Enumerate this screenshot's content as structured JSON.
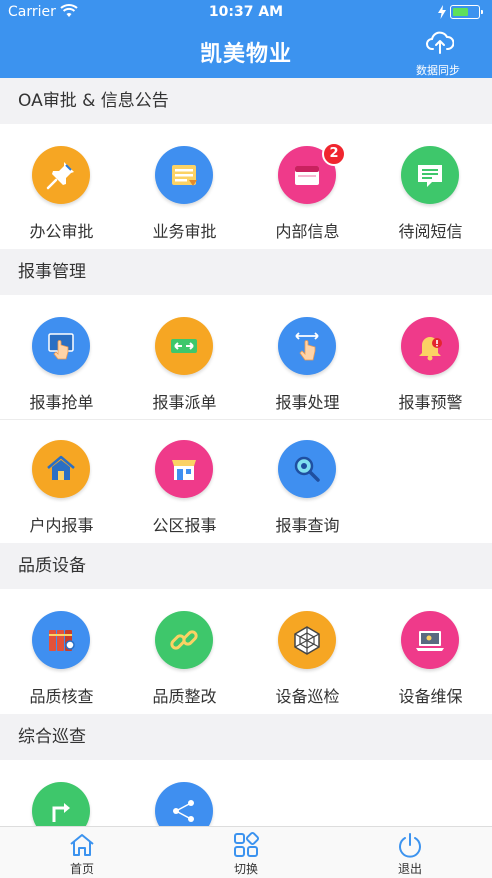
{
  "status": {
    "carrier": "Carrier",
    "time": "10:37 AM",
    "battery_level": 0.7
  },
  "header": {
    "title": "凯美物业",
    "sync_label": "数据同步",
    "sync_icon": "cloud-sync-icon"
  },
  "sections": [
    {
      "title": "OA审批 & 信息公告"
    },
    {
      "title": "报事管理"
    },
    {
      "title": "品质设备"
    },
    {
      "title": "综合巡查"
    }
  ],
  "tiles": {
    "oa": [
      {
        "label": "办公审批",
        "icon": "pushpin-icon",
        "color": "#f6a623"
      },
      {
        "label": "业务审批",
        "icon": "document-list-icon",
        "color": "#3f8ff0"
      },
      {
        "label": "内部信息",
        "icon": "message-box-icon",
        "color": "#ef3a8a",
        "badge": "2"
      },
      {
        "label": "待阅短信",
        "icon": "chat-bubble-icon",
        "color": "#3ec76b"
      }
    ],
    "report1": [
      {
        "label": "报事抢单",
        "icon": "touch-screen-icon",
        "color": "#3f8ff0"
      },
      {
        "label": "报事派单",
        "icon": "transfer-arrows-icon",
        "color": "#f6a623"
      },
      {
        "label": "报事处理",
        "icon": "hand-swipe-icon",
        "color": "#3f8ff0"
      },
      {
        "label": "报事预警",
        "icon": "alarm-bell-icon",
        "color": "#ef3a8a"
      }
    ],
    "report2": [
      {
        "label": "户内报事",
        "icon": "house-icon",
        "color": "#f6a623"
      },
      {
        "label": "公区报事",
        "icon": "storefront-icon",
        "color": "#ef3a8a"
      },
      {
        "label": "报事查询",
        "icon": "magnifier-icon",
        "color": "#3f8ff0"
      }
    ],
    "quality": [
      {
        "label": "品质核查",
        "icon": "binders-icon",
        "color": "#3f8ff0"
      },
      {
        "label": "品质整改",
        "icon": "chain-link-icon",
        "color": "#3ec76b"
      },
      {
        "label": "设备巡检",
        "icon": "network-polygon-icon",
        "color": "#f6a623"
      },
      {
        "label": "设备维保",
        "icon": "laptop-tool-icon",
        "color": "#ef3a8a"
      }
    ],
    "patrol": [
      {
        "icon": "turn-arrow-icon",
        "color": "#3ec76b"
      },
      {
        "icon": "share-nodes-icon",
        "color": "#3f8ff0"
      }
    ]
  },
  "tabbar": [
    {
      "label": "首页",
      "icon": "home-icon",
      "color": "#3c93ef"
    },
    {
      "label": "切换",
      "icon": "grid-switch-icon",
      "color": "#3c93ef"
    },
    {
      "label": "退出",
      "icon": "power-icon",
      "color": "#3c93ef"
    }
  ]
}
